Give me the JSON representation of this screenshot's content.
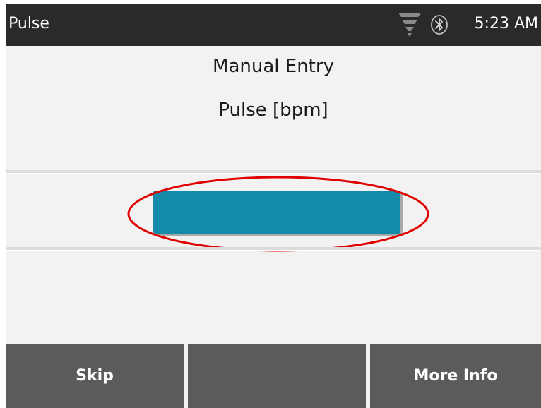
{
  "status_bar": {
    "app_title": "Pulse",
    "time": "5:23 AM",
    "signal_icon": "signal-strength-icon",
    "bluetooth_icon": "bluetooth-icon"
  },
  "main": {
    "title": "Manual Entry",
    "field_label": "Pulse [bpm]",
    "input_value": "",
    "input_color": "#138aa8",
    "highlight_color": "#e00000"
  },
  "footer": {
    "left_label": "Skip",
    "middle_label": "",
    "right_label": "More Info",
    "button_color": "#5b5b5d"
  }
}
